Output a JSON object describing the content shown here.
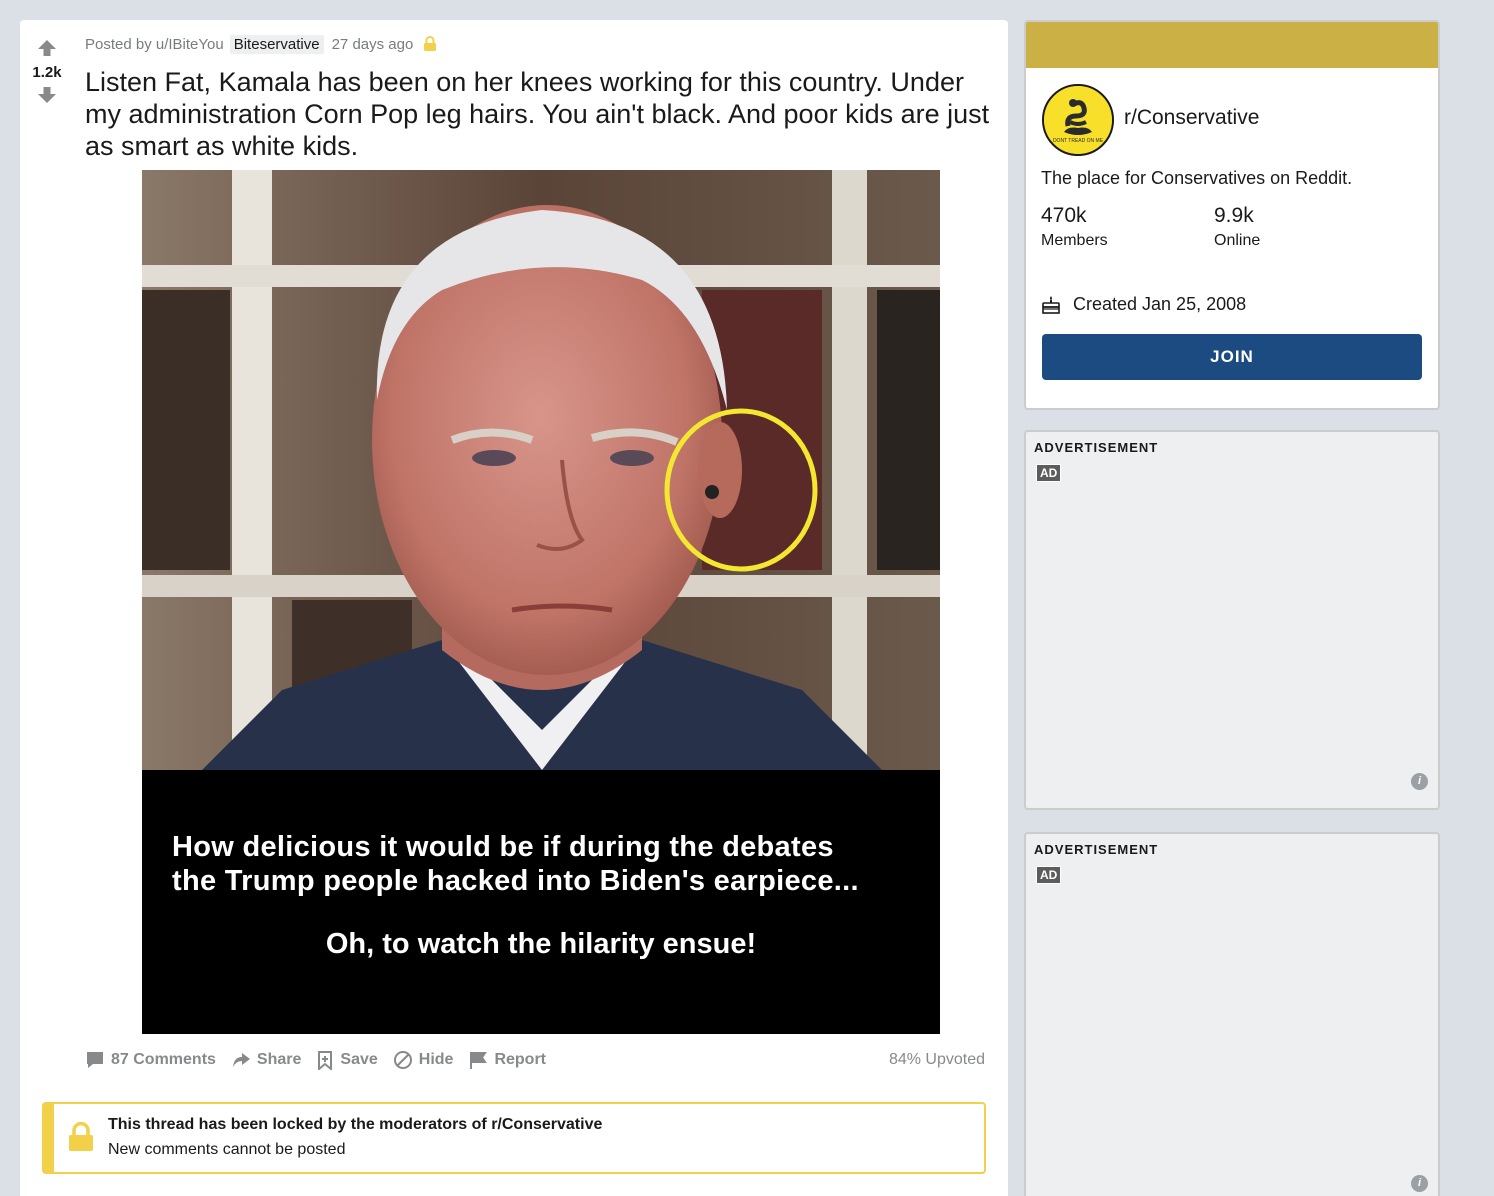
{
  "post": {
    "score": "1.2k",
    "posted_by": "Posted by u/IBiteYou",
    "flair": "Biteservative",
    "time_ago": "27 days ago",
    "title": "Listen Fat, Kamala has been on her knees working for this country. Under my administration Corn Pop leg hairs. You ain't black. And poor kids are just as smart as white kids.",
    "image": {
      "caption_line1": "How delicious it would be if during the debates",
      "caption_line2": "the Trump people  hacked into Biden's earpiece...",
      "caption_line3": "Oh, to watch  the hilarity ensue!"
    },
    "actions": {
      "comments": "87 Comments",
      "share": "Share",
      "save": "Save",
      "hide": "Hide",
      "report": "Report"
    },
    "upvoted": "84% Upvoted",
    "locked": {
      "title": "This thread has been locked by the moderators of r/Conservative",
      "subtitle": "New comments cannot be posted"
    }
  },
  "sidebar": {
    "community_name": "r/Conservative",
    "description": "The place for Conservatives on Reddit.",
    "members_count": "470k",
    "members_label": "Members",
    "online_count": "9.9k",
    "online_label": "Online",
    "created": "Created Jan 25, 2008",
    "join_label": "JOIN",
    "logo_text": "DONT TREAD ON ME",
    "banner_color": "#cbb045",
    "join_color": "#1c4b82"
  },
  "ads": [
    {
      "label": "ADVERTISEMENT",
      "badge": "AD"
    },
    {
      "label": "ADVERTISEMENT",
      "badge": "AD"
    }
  ],
  "colors": {
    "lock_yellow": "#f2d04a",
    "accent_text": "#878a8c"
  }
}
